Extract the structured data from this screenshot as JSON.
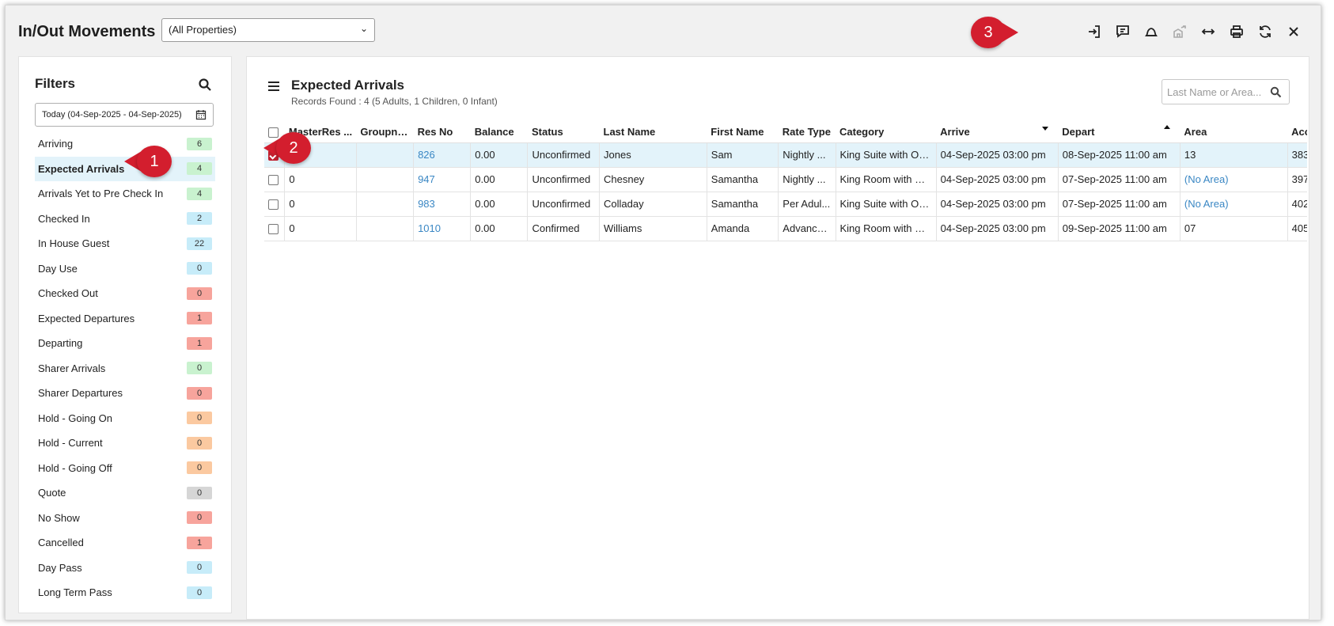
{
  "app": {
    "title": "In/Out Movements"
  },
  "property_select": {
    "value": "(All Properties)"
  },
  "toolbar": {
    "buttons": [
      {
        "name": "check-in-icon",
        "disabled": false
      },
      {
        "name": "message-icon",
        "disabled": false
      },
      {
        "name": "bell-icon",
        "disabled": false
      },
      {
        "name": "room-move-icon",
        "disabled": true
      },
      {
        "name": "resize-icon",
        "disabled": false
      },
      {
        "name": "print-icon",
        "disabled": false
      },
      {
        "name": "refresh-icon",
        "disabled": false
      },
      {
        "name": "close-icon",
        "disabled": false
      }
    ]
  },
  "callouts": {
    "one": "1",
    "two": "2",
    "three": "3"
  },
  "filters": {
    "title": "Filters",
    "date_range": "Today (04-Sep-2025 - 04-Sep-2025)",
    "items": [
      {
        "label": "Arriving",
        "count": "6",
        "color": "#c9f2cf"
      },
      {
        "label": "Expected Arrivals",
        "count": "4",
        "color": "#c9f2cf",
        "active": true
      },
      {
        "label": "Arrivals Yet to Pre Check In",
        "count": "4",
        "color": "#c9f2cf"
      },
      {
        "label": "Checked In",
        "count": "2",
        "color": "#c7ecf9"
      },
      {
        "label": "In House Guest",
        "count": "22",
        "color": "#c7ecf9"
      },
      {
        "label": "Day Use",
        "count": "0",
        "color": "#c7ecf9"
      },
      {
        "label": "Checked Out",
        "count": "0",
        "color": "#f7a49c"
      },
      {
        "label": "Expected Departures",
        "count": "1",
        "color": "#f7a49c"
      },
      {
        "label": "Departing",
        "count": "1",
        "color": "#f7a49c"
      },
      {
        "label": "Sharer Arrivals",
        "count": "0",
        "color": "#c9f2cf"
      },
      {
        "label": "Sharer Departures",
        "count": "0",
        "color": "#f7a49c"
      },
      {
        "label": "Hold - Going On",
        "count": "0",
        "color": "#fbc9a0"
      },
      {
        "label": "Hold - Current",
        "count": "0",
        "color": "#fbc9a0"
      },
      {
        "label": "Hold - Going Off",
        "count": "0",
        "color": "#fbc9a0"
      },
      {
        "label": "Quote",
        "count": "0",
        "color": "#d6d6d6"
      },
      {
        "label": "No Show",
        "count": "0",
        "color": "#f7a49c"
      },
      {
        "label": "Cancelled",
        "count": "1",
        "color": "#f7a49c"
      },
      {
        "label": "Day Pass",
        "count": "0",
        "color": "#c7ecf9"
      },
      {
        "label": "Long Term Pass",
        "count": "0",
        "color": "#c7ecf9"
      }
    ]
  },
  "main": {
    "title": "Expected Arrivals",
    "records": "Records Found : 4 (5 Adults, 1 Children, 0 Infant)",
    "search_placeholder": "Last Name or Area...",
    "columns": [
      "",
      "MasterRes ...",
      "Groupna...",
      "Res No",
      "Balance",
      "Status",
      "Last Name",
      "First Name",
      "Rate Type",
      "Category",
      "Arrive",
      "Depart",
      "Area",
      "Acc"
    ],
    "rows": [
      {
        "checked": true,
        "master": "",
        "group": "",
        "resno": "826",
        "balance": "0.00",
        "status": "Unconfirmed",
        "last": "Jones",
        "first": "Sam",
        "rate": "Nightly ...",
        "category": "King Suite with Oc...",
        "arrive": "04-Sep-2025 03:00 pm",
        "depart": "08-Sep-2025 11:00 am",
        "area": "13",
        "area_link": false,
        "acc": "383"
      },
      {
        "checked": false,
        "master": "0",
        "group": "",
        "resno": "947",
        "balance": "0.00",
        "status": "Unconfirmed",
        "last": "Chesney",
        "first": "Samantha",
        "rate": "Nightly ...",
        "category": "King Room with Ci...",
        "arrive": "04-Sep-2025 03:00 pm",
        "depart": "07-Sep-2025 11:00 am",
        "area": "(No Area)",
        "area_link": true,
        "acc": "397"
      },
      {
        "checked": false,
        "master": "0",
        "group": "",
        "resno": "983",
        "balance": "0.00",
        "status": "Unconfirmed",
        "last": "Colladay",
        "first": "Samantha",
        "rate": "Per Adul...",
        "category": "King Suite with Oc...",
        "arrive": "04-Sep-2025 03:00 pm",
        "depart": "07-Sep-2025 11:00 am",
        "area": "(No Area)",
        "area_link": true,
        "acc": "402"
      },
      {
        "checked": false,
        "master": "0",
        "group": "",
        "resno": "1010",
        "balance": "0.00",
        "status": "Confirmed",
        "last": "Williams",
        "first": "Amanda",
        "rate": "Advance...",
        "category": "King Room with Ci...",
        "arrive": "04-Sep-2025 03:00 pm",
        "depart": "09-Sep-2025 11:00 am",
        "area": "07",
        "area_link": false,
        "acc": "405"
      }
    ]
  }
}
